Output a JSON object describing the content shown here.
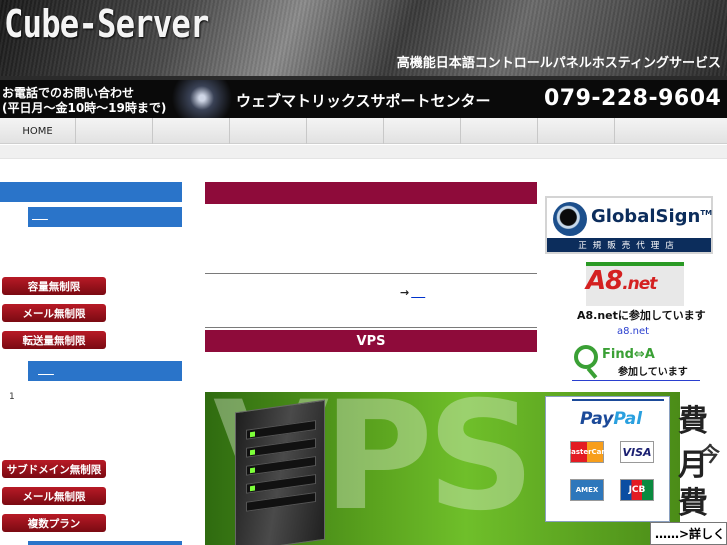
{
  "header": {
    "logo": "Cube-Server",
    "tagline": "高機能日本語コントロールパネルホスティングサービス"
  },
  "contact": {
    "line1": "お電話でのお問い合わせ",
    "line2": "(平日月〜金10時〜19時まで)",
    "support_center": "ウェブマトリックスサポートセンター",
    "phone": "079-228-9604"
  },
  "nav": {
    "items": [
      "HOME",
      "",
      "",
      "",
      "",
      "",
      "",
      ""
    ]
  },
  "left": {
    "buttons_a": [
      "容量無制限",
      "メール無制限",
      "転送量無制限"
    ],
    "number": "1",
    "buttons_b": [
      "サブドメイン無制限",
      "メール無制限",
      "複数プラン"
    ]
  },
  "center": {
    "arrow": "→",
    "vps_label": "VPS",
    "vps_banner_text": "VPS",
    "banner_right": {
      "line1": "費月",
      "line2": "今",
      "line3": "費月",
      "details": "……>詳しく"
    }
  },
  "right": {
    "globalsign": {
      "name": "GlobalSign",
      "tm": "TM",
      "sub": "正規販売代理店"
    },
    "a8": {
      "logo": "A8",
      "logo_suffix": ".net",
      "text": "A8.netに参加しています",
      "link": "a8.net"
    },
    "find": {
      "word": "Find⇔A",
      "sub": "参加しています"
    },
    "paypal": {
      "name_a": "Pay",
      "name_b": "Pal",
      "cards": [
        "MasterCard",
        "VISA",
        "AMEX",
        "JCB"
      ]
    }
  }
}
